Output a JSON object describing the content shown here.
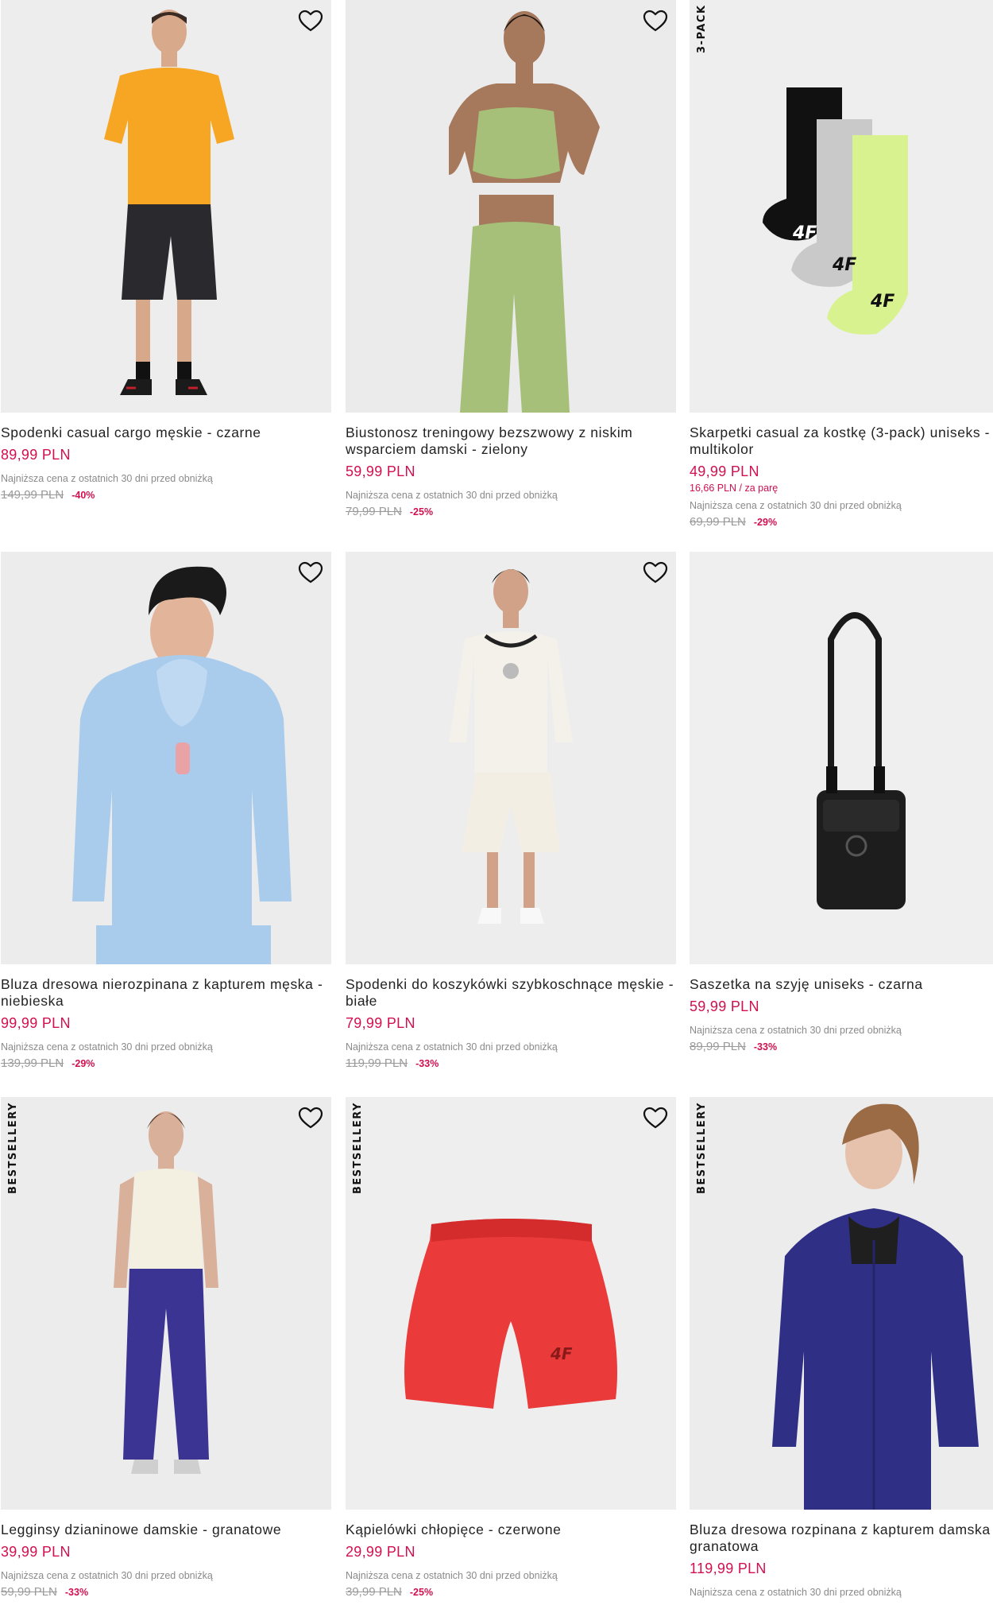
{
  "products": [
    {
      "title": "Spodenki casual cargo męskie - czarne",
      "price": "89,99 PLN",
      "lowest_label": "Najniższa cena z ostatnich 30 dni przed obniżką",
      "old_price": "149,99 PLN",
      "discount": "-40%",
      "icon": "heart-icon",
      "image": "man-orange-tshirt-black-shorts"
    },
    {
      "title": "Biustonosz treningowy bezszwowy z niskim wsparciem damski - zielony",
      "price": "59,99 PLN",
      "lowest_label": "Najniższa cena z ostatnich 30 dni przed obniżką",
      "old_price": "79,99 PLN",
      "discount": "-25%",
      "icon": "heart-icon",
      "image": "woman-green-sports-set"
    },
    {
      "badge": "3-PACK",
      "title": "Skarpetki casual za kostkę (3-pack) uniseks - multikolor",
      "price": "49,99 PLN",
      "unit_price": "16,66 PLN / za parę",
      "lowest_label": "Najniższa cena z ostatnich 30 dni przed obniżką",
      "old_price": "69,99 PLN",
      "discount": "-29%",
      "icon": "heart-icon",
      "image": "three-socks"
    },
    {
      "title": "Bluza dresowa nierozpinana z kapturem męska - niebieska",
      "price": "99,99 PLN",
      "lowest_label": "Najniższa cena z ostatnich 30 dni przed obniżką",
      "old_price": "139,99 PLN",
      "discount": "-29%",
      "icon": "heart-icon",
      "image": "man-blue-hoodie"
    },
    {
      "title": "Spodenki do koszykówki szybkoschnące męskie - białe",
      "price": "79,99 PLN",
      "lowest_label": "Najniższa cena z ostatnich 30 dni przed obniżką",
      "old_price": "119,99 PLN",
      "discount": "-33%",
      "icon": "heart-icon",
      "image": "man-white-basketball-set"
    },
    {
      "title": "Saszetka na szyję uniseks - czarna",
      "price": "59,99 PLN",
      "lowest_label": "Najniższa cena z ostatnich 30 dni przed obniżką",
      "old_price": "89,99 PLN",
      "discount": "-33%",
      "icon": "heart-icon",
      "image": "black-neck-pouch"
    },
    {
      "badge": "BESTSELLERY",
      "title": "Legginsy dzianinowe damskie - granatowe",
      "price": "39,99 PLN",
      "lowest_label": "Najniższa cena z ostatnich 30 dni przed obniżką",
      "old_price": "59,99 PLN",
      "discount": "-33%",
      "icon": "heart-icon",
      "image": "woman-navy-leggings"
    },
    {
      "badge": "BESTSELLERY",
      "title": "Kąpielówki chłopięce - czerwone",
      "price": "29,99 PLN",
      "lowest_label": "Najniższa cena z ostatnich 30 dni przed obniżką",
      "old_price": "39,99 PLN",
      "discount": "-25%",
      "icon": "heart-icon",
      "image": "red-swim-shorts"
    },
    {
      "badge": "BESTSELLERY",
      "title": "Bluza dresowa rozpinana z kapturem damska - granatowa",
      "price": "119,99 PLN",
      "lowest_label": "Najniższa cena z ostatnich 30 dni przed obniżką",
      "icon": "heart-icon",
      "image": "woman-navy-zip-hoodie"
    }
  ],
  "colors": {
    "price": "#d0104f",
    "text": "#222222",
    "muted": "#8a8a8a",
    "photo_bg": "#eeeeee"
  }
}
